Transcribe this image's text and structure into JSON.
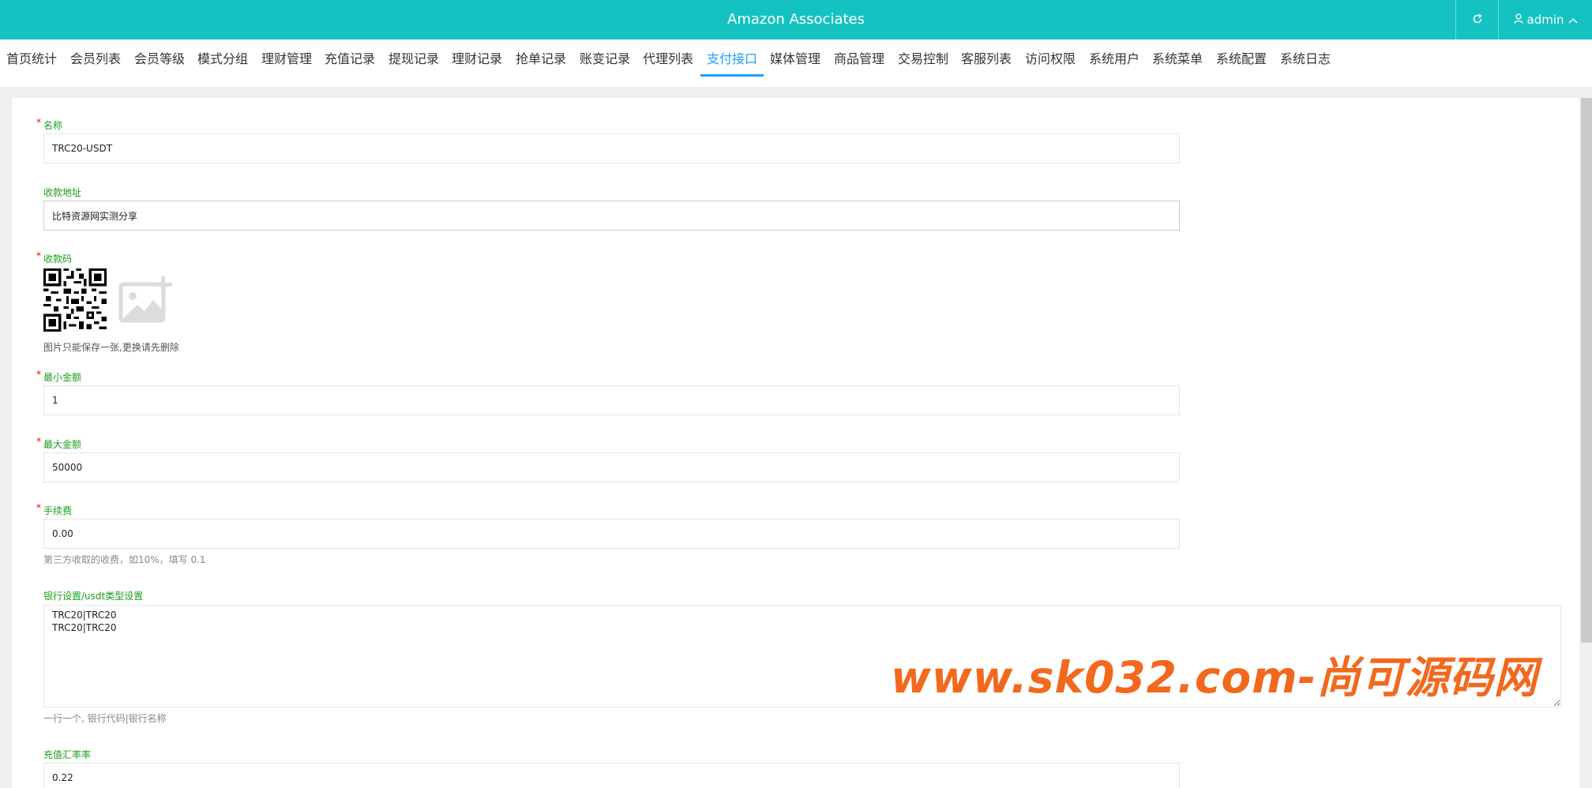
{
  "header": {
    "title": "Amazon Associates",
    "refresh_icon": "refresh-icon",
    "user_icon": "user-icon",
    "user_name": "admin",
    "caret_icon": "chevron-up-icon",
    "bg_color": "#15c2c2"
  },
  "nav": {
    "active_color": "#1e9fff",
    "items": [
      {
        "label": "首页统计"
      },
      {
        "label": "会员列表"
      },
      {
        "label": "会员等级"
      },
      {
        "label": "模式分组"
      },
      {
        "label": "理财管理"
      },
      {
        "label": "充值记录"
      },
      {
        "label": "提现记录"
      },
      {
        "label": "理财记录"
      },
      {
        "label": "抢单记录"
      },
      {
        "label": "账变记录"
      },
      {
        "label": "代理列表"
      },
      {
        "label": "支付接口",
        "active": true
      },
      {
        "label": "媒体管理"
      },
      {
        "label": "商品管理"
      },
      {
        "label": "交易控制"
      },
      {
        "label": "客服列表"
      },
      {
        "label": "访问权限"
      },
      {
        "label": "系统用户"
      },
      {
        "label": "系统菜单"
      },
      {
        "label": "系统配置"
      },
      {
        "label": "系统日志"
      }
    ]
  },
  "form": {
    "name": {
      "label": "名称",
      "value": "TRC20-USDT",
      "required": "*"
    },
    "address": {
      "label": "收款地址",
      "value": "比特资源网实测分享"
    },
    "qrcode": {
      "label": "收款码",
      "required": "*",
      "hint": "图片只能保存一张,更换请先删除",
      "qr_icon": "qr-code-image",
      "upload_icon": "add-image-icon"
    },
    "min_amount": {
      "label": "最小金额",
      "value": "1",
      "required": "*"
    },
    "max_amount": {
      "label": "最大金额",
      "value": "50000",
      "required": "*"
    },
    "fee": {
      "label": "手续费",
      "value": "0.00",
      "required": "*",
      "hint": "第三方收取的收费，如10%，填写 0.1"
    },
    "bank_settings": {
      "label": "银行设置/usdt类型设置",
      "value": "TRC20|TRC20\nTRC20|TRC20",
      "hint": "一行一个, 银行代码|银行名称"
    },
    "exchange_rate": {
      "label": "充值汇率率",
      "value": "0.22"
    }
  },
  "watermark": {
    "text": "www.sk032.com-尚可源码网",
    "color": "#f2691e"
  }
}
